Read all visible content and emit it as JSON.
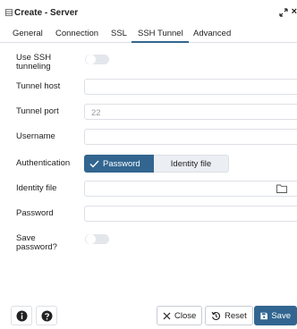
{
  "window": {
    "title": "Create - Server",
    "close_glyph": "×"
  },
  "tabs": [
    {
      "label": "General"
    },
    {
      "label": "Connection"
    },
    {
      "label": "SSL"
    },
    {
      "label": "SSH Tunnel"
    },
    {
      "label": "Advanced"
    }
  ],
  "active_tab": "SSH Tunnel",
  "form": {
    "use_ssh_label_1": "Use SSH",
    "use_ssh_label_2": "tunneling",
    "use_ssh_on": false,
    "tunnel_host_label": "Tunnel host",
    "tunnel_host_value": "",
    "tunnel_port_label": "Tunnel port",
    "tunnel_port_value": "22",
    "username_label": "Username",
    "username_value": "",
    "auth_label": "Authentication",
    "auth_options": [
      "Password",
      "Identity file"
    ],
    "auth_selected": "Password",
    "identity_file_label": "Identity file",
    "identity_file_value": "",
    "password_label": "Password",
    "password_value": "",
    "save_pw_label_1": "Save",
    "save_pw_label_2": "password?",
    "save_pw_on": false
  },
  "footer": {
    "close_label": "Close",
    "reset_label": "Reset",
    "save_label": "Save"
  },
  "colors": {
    "accent": "#326690",
    "toggle_off": "#e3e6ea",
    "border": "#dde0e6"
  },
  "icons": {
    "title": "server-icon",
    "expand": "expand-icon",
    "close": "close-icon",
    "info": "info-icon",
    "help": "help-icon",
    "close_btn": "x-icon",
    "reset": "reset-icon",
    "save": "floppy-icon",
    "folder": "folder-icon",
    "check": "check-icon"
  }
}
